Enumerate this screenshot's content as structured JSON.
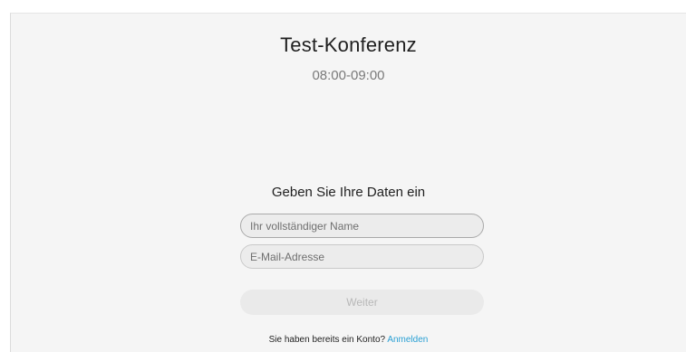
{
  "meeting": {
    "title": "Test-Konferenz",
    "time": "08:00-09:00"
  },
  "form": {
    "heading": "Geben Sie Ihre Daten ein",
    "name_placeholder": "Ihr vollständiger Name",
    "email_placeholder": "E-Mail-Adresse",
    "submit_label": "Weiter"
  },
  "footer": {
    "prompt": "Sie haben bereits ein Konto?",
    "signin_link": "Anmelden"
  },
  "colors": {
    "link": "#2aa0d4",
    "background": "#f5f5f5"
  }
}
